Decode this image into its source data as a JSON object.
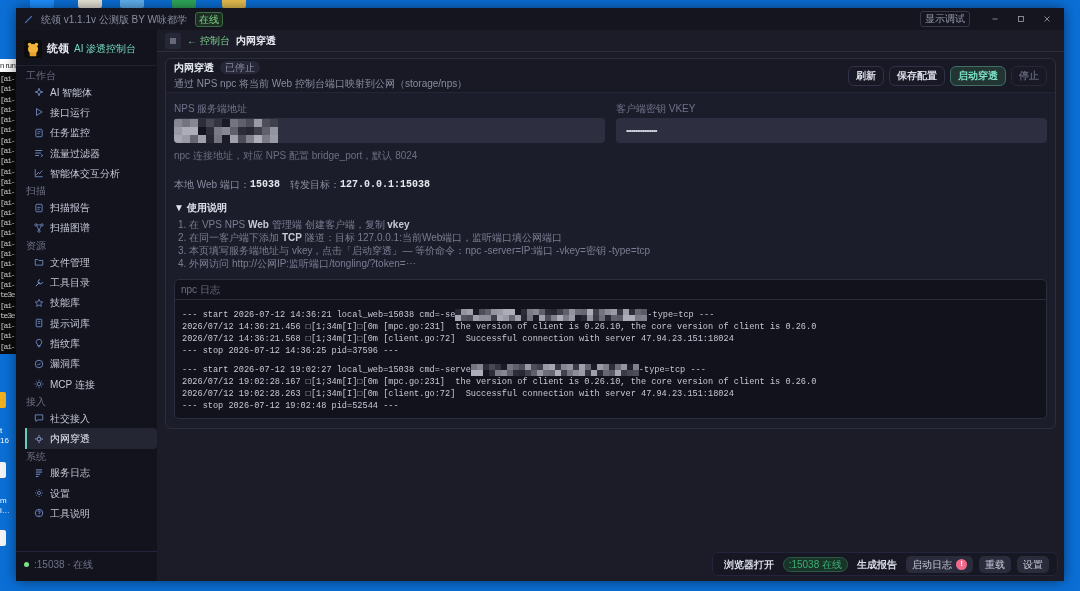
{
  "desktop": {
    "note_text": "n run",
    "terminal_lines": [
      "[ai-",
      "[ai-",
      "[ai-",
      "[ai-",
      "[ai-",
      "[ai-",
      "[ai-",
      "[ai-",
      "[ai-",
      "[ai-",
      "[ai-",
      "[ai-",
      "[ai-",
      "[ai-",
      "[ai-",
      "[ai-",
      "[ai-",
      "[ai-",
      "[ai-",
      "[ai-",
      "[ai-",
      "te3e",
      "[ai-",
      "te3e",
      "[ai-",
      "[ai-",
      "[ai-"
    ],
    "icon_labels": [
      {
        "lines": [
          "t",
          "16"
        ]
      },
      {
        "lines": [
          "m",
          "i…"
        ]
      }
    ]
  },
  "window": {
    "title": "统领 v1.1.1v 公测版 BY W咏都学",
    "status_badge": "在线",
    "debug_button": "显示调试"
  },
  "sidebar": {
    "brand": "统领",
    "tagline": "AI 渗透控制台",
    "footer": ":15038 · 在线",
    "online": true,
    "sections": [
      {
        "label": "工作台",
        "items": [
          {
            "label": "AI 智能体",
            "selected": false
          },
          {
            "label": "接口运行",
            "selected": false
          },
          {
            "label": "任务监控",
            "selected": false
          },
          {
            "label": "流量过滤器",
            "selected": false
          },
          {
            "label": "智能体交互分析",
            "selected": false
          }
        ]
      },
      {
        "label": "扫描",
        "items": [
          {
            "label": "扫描报告",
            "selected": false
          },
          {
            "label": "扫描图谱",
            "selected": false
          }
        ]
      },
      {
        "label": "资源",
        "items": [
          {
            "label": "文件管理",
            "selected": false
          },
          {
            "label": "工具目录",
            "selected": false
          },
          {
            "label": "技能库",
            "selected": false
          },
          {
            "label": "提示词库",
            "selected": false
          },
          {
            "label": "指纹库",
            "selected": false
          },
          {
            "label": "漏洞库",
            "selected": false
          },
          {
            "label": "MCP 连接",
            "selected": false
          }
        ]
      },
      {
        "label": "接入",
        "items": [
          {
            "label": "社交接入",
            "selected": false
          },
          {
            "label": "内网穿透",
            "selected": true
          }
        ]
      },
      {
        "label": "系统",
        "items": [
          {
            "label": "服务日志",
            "selected": false
          },
          {
            "label": "设置",
            "selected": false
          },
          {
            "label": "工具说明",
            "selected": false
          }
        ]
      }
    ]
  },
  "header": {
    "back_link": "← 控制台",
    "title": "内网穿透"
  },
  "panel": {
    "title": "内网穿透",
    "status": "已停止",
    "subtitle": "通过 NPS npc 将当前 Web 控制台端口映射到公网（storage/nps）",
    "buttons": [
      {
        "label": "刷新",
        "kind": "default",
        "disabled": false
      },
      {
        "label": "保存配置",
        "kind": "default",
        "disabled": false
      },
      {
        "label": "启动穿透",
        "kind": "primary",
        "disabled": false
      },
      {
        "label": "停止",
        "kind": "default",
        "disabled": true
      }
    ],
    "fields": [
      {
        "label": "NPS 服务端地址",
        "kind": "redacted"
      },
      {
        "label": "客户端密钥 VKEY",
        "kind": "password",
        "value": "•••••••••••••••••"
      }
    ],
    "hint": "npc 连接地址，对应 NPS 配置 bridge_port，默认 8024",
    "port_label": "本地 Web 端口：",
    "port_value": "15038",
    "target_label": "转发目标：",
    "target_value": "127.0.0.1:15038",
    "help": {
      "title": "使用说明",
      "expanded": true,
      "toggle": "▼",
      "steps": [
        "1. 在 VPS NPS **Web** 管理端 创建客户端，复制 **vkey**",
        "2. 在同一客户端下添加 **TCP** 隧道：目标 127.0.0.1:当前Web端口，监听端口填公网端口",
        "3. 本页填写服务端地址与 vkey，点击「启动穿透」— 等价命令：npc -server=IP:端口 -vkey=密钥 -type=tcp",
        "4. 外网访问 http://公网IP:监听端口/tongling/?token=⋯"
      ]
    },
    "log": {
      "title": "npc 日志",
      "groups": [
        {
          "lines": [
            {
              "kind": "redacted",
              "before": "--- start 2026-07-12 14:36:21 local_web=15038 cmd=-se",
              "after": "-type=tcp ---"
            },
            {
              "kind": "text",
              "text": "2026/07/12 14:36:21.456 □[1;34m[I]□[0m [mpc.go:231]  the version of client is 0.26.10, the core version of client is 0.26.0"
            },
            {
              "kind": "text",
              "text": "2026/07/12 14:36:21.568 □[1;34m[I]□[0m [client.go:72]  Successful connection with server 47.94.23.151:18024"
            },
            {
              "kind": "text",
              "text": "--- stop 2026-07-12 14:36:25 pid=37596 ---"
            }
          ]
        },
        {
          "lines": [
            {
              "kind": "redacted",
              "before": "--- start 2026-07-12 19:02:27 local_web=15038 cmd=-serve",
              "after": "-type=tcp ---"
            },
            {
              "kind": "text",
              "text": "2026/07/12 19:02:28.167 □[1;34m[I]□[0m [mpc.go:231]  the version of client is 0.26.10, the core version of client is 0.26.0"
            },
            {
              "kind": "text",
              "text": "2026/07/12 19:02:28.263 □[1;34m[I]□[0m [client.go:72]  Successful connection with server 47.94.23.151:18024"
            },
            {
              "kind": "text",
              "text": "--- stop 2026-07-12 19:02:48 pid=52544 ---"
            }
          ]
        }
      ]
    }
  },
  "action_bar": {
    "items": [
      {
        "label": "浏览器打开",
        "kind": "text"
      },
      {
        "label": ":15038 在线",
        "kind": "status"
      },
      {
        "label": "生成报告",
        "kind": "text"
      },
      {
        "label": "启动日志",
        "kind": "button",
        "alert": "!"
      },
      {
        "label": "重载",
        "kind": "button"
      },
      {
        "label": "设置",
        "kind": "button"
      }
    ]
  }
}
